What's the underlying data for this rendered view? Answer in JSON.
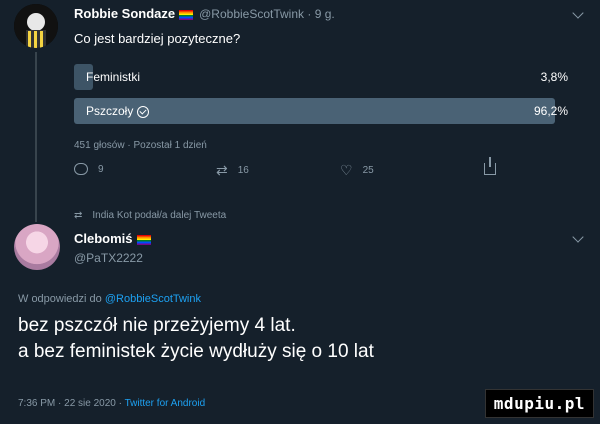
{
  "tweet": {
    "author_name": "Robbie Sondaze",
    "author_handle": "@RobbieScotTwink",
    "time_ago": "9 g.",
    "question": "Co jest bardziej pozyteczne?",
    "poll": [
      {
        "label": "Feministki",
        "percent": "3,8%",
        "fraction": 0.038,
        "winner": false
      },
      {
        "label": "Pszczoły",
        "percent": "96,2%",
        "fraction": 0.962,
        "winner": true
      }
    ],
    "poll_meta": "451 głosów · Pozostał 1 dzień",
    "replies": "9",
    "retweets": "16",
    "likes": "25",
    "retweet_note": "India Kot podał/a dalej Tweeta"
  },
  "reply": {
    "author_name": "Clebomiś",
    "author_handle": "@PaTX2222",
    "reply_to_prefix": "W odpowiedzi do",
    "reply_to_handle": "@RobbieScotTwink",
    "line1": "bez pszczół nie przeżyjemy 4 lat.",
    "line2": "a bez feministek życie wydłuży się o 10 lat",
    "timestamp": "7:36 PM · 22 sie 2020 ·",
    "client": "Twitter for Android"
  },
  "watermark": "mdupiu.pl",
  "colors": {
    "background": "#15202b",
    "muted": "#8899a6",
    "link": "#1da1f2",
    "poll_bar": "#4a6275"
  },
  "icons": {
    "reply": "reply-icon",
    "retweet": "retweet-icon",
    "like": "heart-icon",
    "share": "share-icon",
    "more": "chevron-down-icon",
    "poll_winner": "check-icon"
  }
}
